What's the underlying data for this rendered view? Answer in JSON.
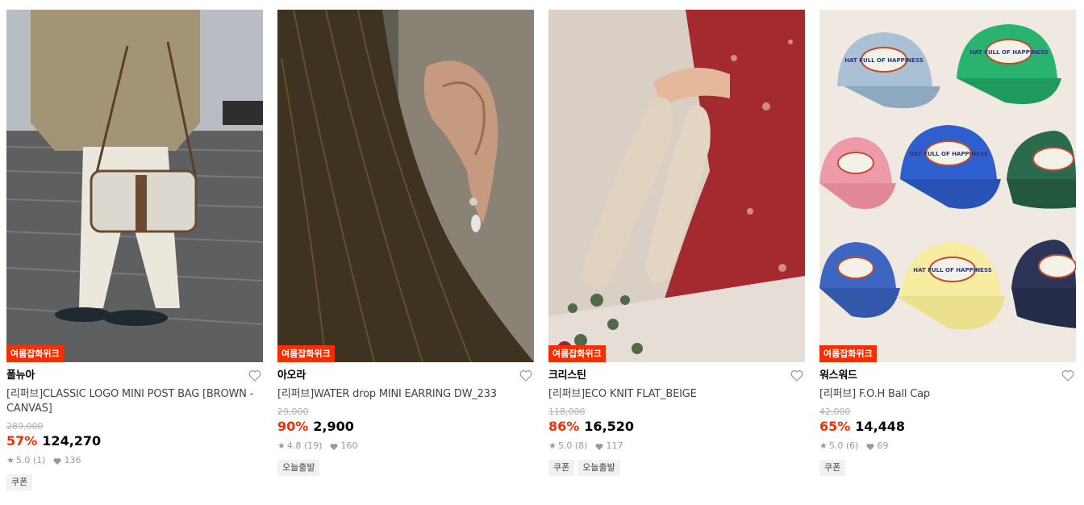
{
  "products": [
    {
      "image_alt": "bag-photo",
      "badge": "여름잡화위크",
      "brand": "폴뉴아",
      "name": "[리퍼브]CLASSIC LOGO MINI POST BAG [BROWN - CANVAS]",
      "original_price": "289,000",
      "discount": "57%",
      "price": "124,270",
      "rating": "5.0",
      "reviews": "(1)",
      "likes": "136",
      "tags": [
        "쿠폰"
      ]
    },
    {
      "image_alt": "earring-photo",
      "badge": "여름잡화위크",
      "brand": "아오라",
      "name": "[리퍼브]WATER drop MINI EARRING DW_233",
      "original_price": "29,000",
      "discount": "90%",
      "price": "2,900",
      "rating": "4.8",
      "reviews": "(19)",
      "likes": "160",
      "tags": [
        "오늘출발"
      ]
    },
    {
      "image_alt": "flat-shoes-photo",
      "badge": "여름잡화위크",
      "brand": "크리스틴",
      "name": "[리퍼브]ECO KNIT FLAT_BEIGE",
      "original_price": "118,000",
      "discount": "86%",
      "price": "16,520",
      "rating": "5.0",
      "reviews": "(8)",
      "likes": "117",
      "tags": [
        "쿠폰",
        "오늘출발"
      ]
    },
    {
      "image_alt": "ball-cap-photo",
      "badge": "여름잡화위크",
      "brand": "워스워드",
      "name": "[리퍼브] F.O.H Ball Cap",
      "original_price": "42,000",
      "discount": "65%",
      "price": "14,448",
      "rating": "5.0",
      "reviews": "(6)",
      "likes": "69",
      "tags": [
        "쿠폰"
      ]
    }
  ],
  "cap_print": "HAT FULL OF HAPPINESS",
  "colors": {
    "accent": "#fa2d00",
    "muted": "#9a9a9a"
  },
  "icons": {
    "like": "heart-outline-icon",
    "rating": "star-icon",
    "likes": "heart-icon"
  }
}
